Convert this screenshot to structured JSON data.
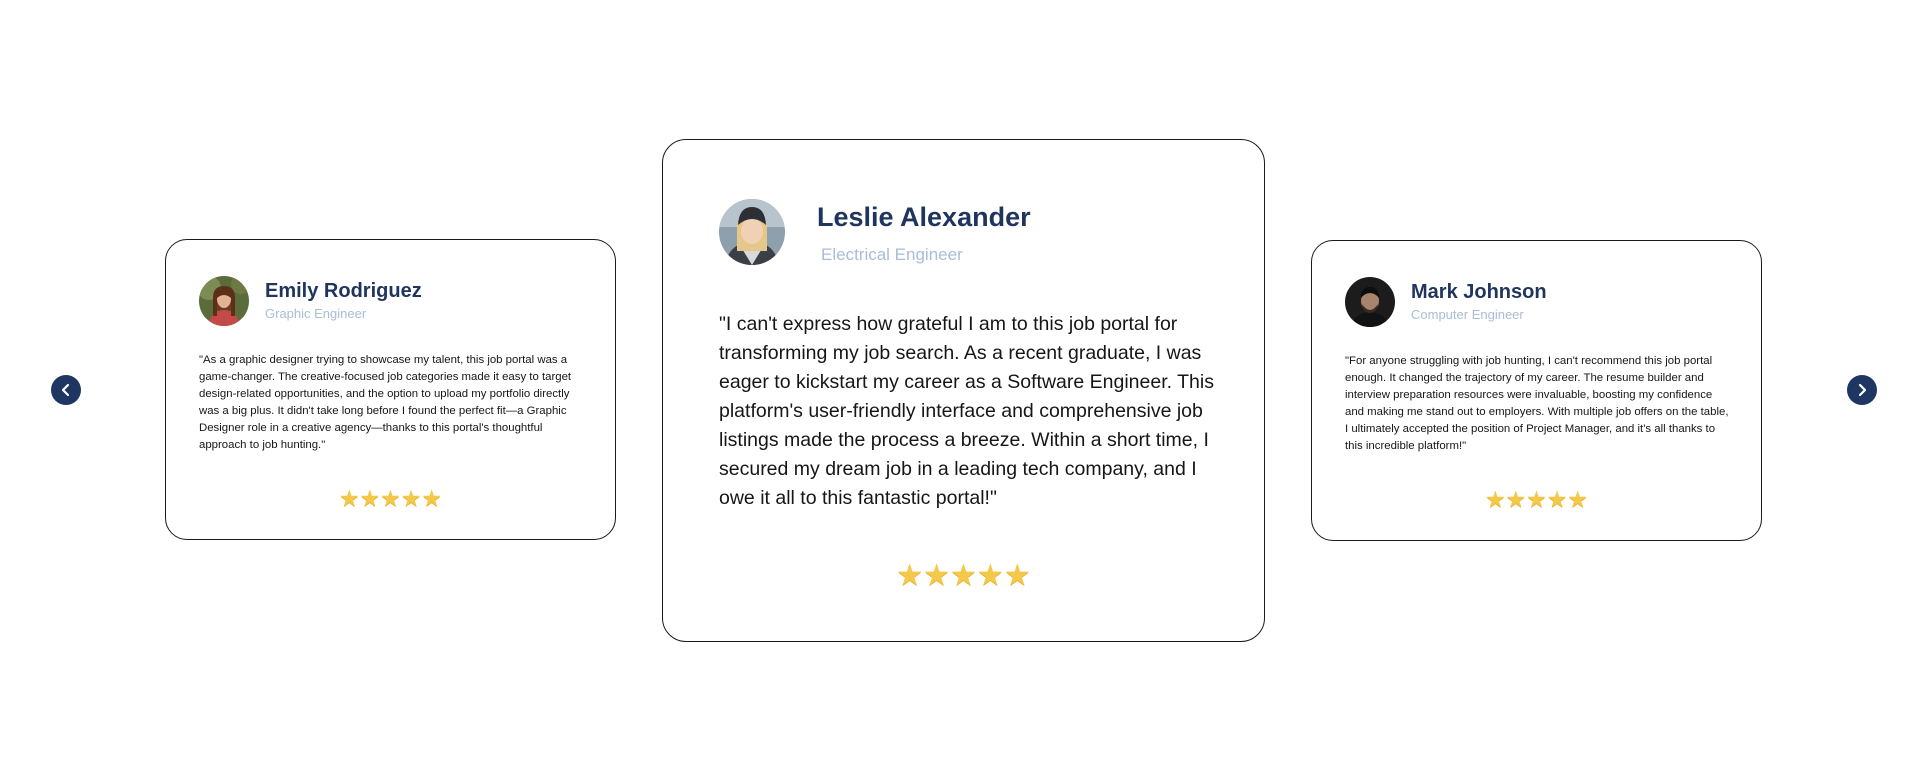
{
  "carousel": {
    "prev_icon": "chevron-left-icon",
    "next_icon": "chevron-right-icon",
    "accent_color": "#1f3562",
    "star_color": "#f4c94a",
    "testimonials": [
      {
        "name": "Emily Rodriguez",
        "role": "Graphic Engineer",
        "quote": "\"As a graphic designer trying to showcase my talent, this job portal was a game-changer. The creative-focused job categories made it easy to target design-related opportunities, and the option to upload my portfolio directly was a big plus. It didn't take long before I found the perfect fit—a Graphic Designer role in a creative agency—thanks to this portal's thoughtful approach to job hunting.\"",
        "rating": 5,
        "stars": "★★★★★"
      },
      {
        "name": "Leslie Alexander",
        "role": "Electrical Engineer",
        "quote": "\"I can't express how grateful I am to this job portal for transforming my job search. As a recent graduate, I was eager to kickstart my career as a Software Engineer. This platform's user-friendly interface and comprehensive job listings made the process a breeze. Within a short time, I secured my dream job in a leading tech company, and I owe it all to this fantastic portal!\"",
        "rating": 5,
        "stars": "★★★★★"
      },
      {
        "name": "Mark Johnson",
        "role": "Computer Engineer",
        "quote": " \"For anyone struggling with job hunting, I can't recommend this job portal enough. It changed the trajectory of my career. The resume builder and interview preparation resources were invaluable, boosting my confidence and making me stand out to employers. With multiple job offers on the table, I ultimately accepted the position of Project Manager, and it's all thanks to this incredible platform!\"",
        "rating": 5,
        "stars": "★★★★★"
      }
    ]
  }
}
